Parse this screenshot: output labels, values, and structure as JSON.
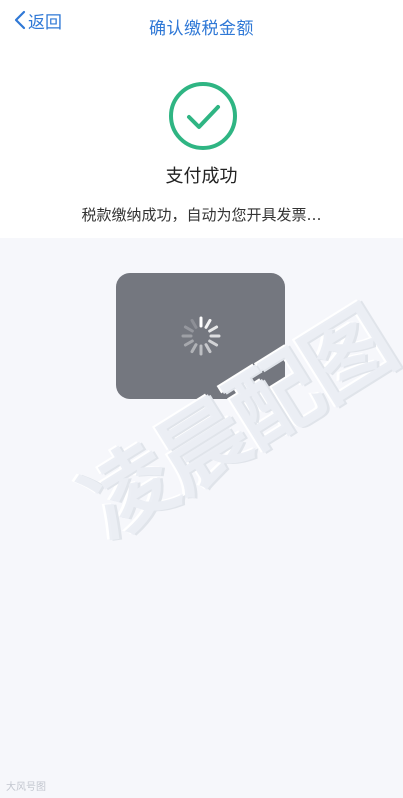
{
  "nav": {
    "back_label": "返回",
    "title": "确认缴税金额"
  },
  "status": {
    "title": "支付成功",
    "description": "税款缴纳成功，自动为您开具发票…"
  },
  "watermark": {
    "text": "凌晨配图",
    "corner_text": "大风号图"
  },
  "colors": {
    "accent": "#2f78d6",
    "success": "#2fb583",
    "overlay": "#74777f",
    "background": "#f6f7fb"
  }
}
